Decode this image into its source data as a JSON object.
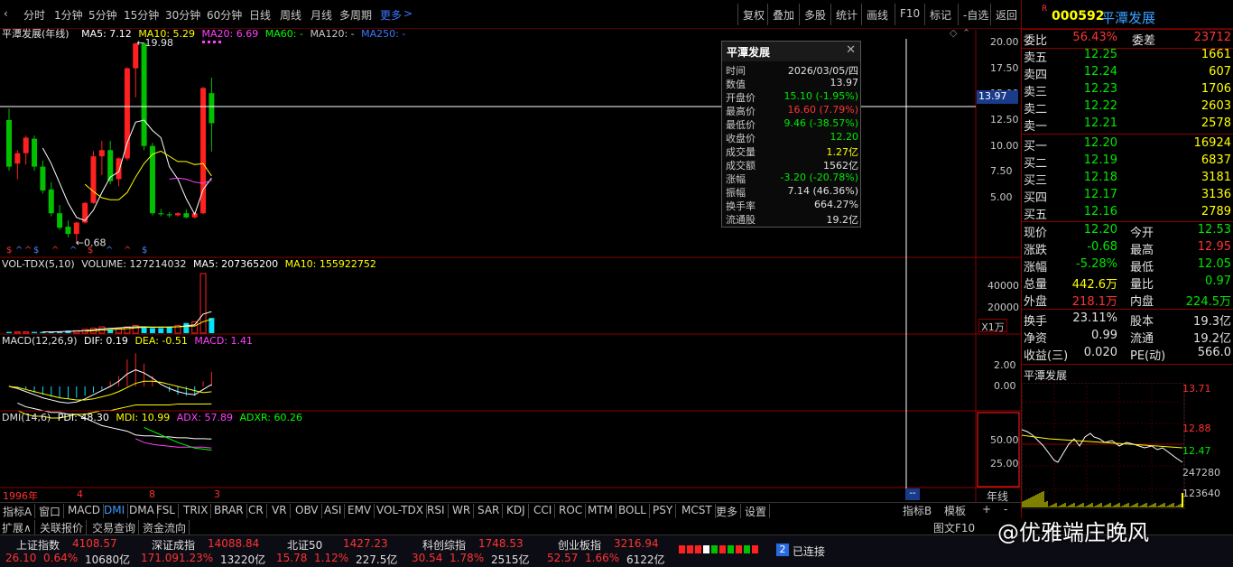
{
  "toolbar": {
    "periods": [
      "分时",
      "1分钟",
      "5分钟",
      "15分钟",
      "30分钟",
      "60分钟",
      "日线",
      "周线",
      "月线",
      "多周期"
    ],
    "more": "更多",
    "actions": [
      "复权",
      "叠加",
      "多股",
      "统计",
      "画线",
      "F10",
      "标记",
      "-自选",
      "返回"
    ]
  },
  "stock": {
    "badge": "R",
    "code": "000592",
    "name": "平潭发展"
  },
  "kline": {
    "title": "平潭发展(年线)",
    "ma5": "MA5: 7.12",
    "ma10": "MA10: 5.29",
    "ma20": "MA20: 6.69",
    "ma60": "MA60: -",
    "ma120": "MA120: -",
    "ma250": "MA250: -",
    "high_label": "19.98",
    "low_label": "0.68",
    "price_ticks": [
      "20.00",
      "17.50",
      "15.00",
      "12.50",
      "10.00",
      "7.50",
      "5.00"
    ],
    "cursor_price": "13.97",
    "colors": {
      "up": "#ff2020",
      "down": "#00c000",
      "ma5": "#ffffff",
      "ma10": "#ffff00",
      "ma20": "#ff40ff",
      "ma60": "#00ff00"
    }
  },
  "volume": {
    "legend_title": "VOL-TDX(5,10)",
    "volume": "VOLUME: 127214032",
    "ma5": "MA5: 207365200",
    "ma10": "MA10: 155922752",
    "ticks": [
      "40000",
      "20000"
    ],
    "unit": "X1万"
  },
  "macd": {
    "legend_title": "MACD(12,26,9)",
    "dif": "DIF: 0.19",
    "dea": "DEA: -0.51",
    "macd": "MACD: 1.41",
    "ticks": [
      "2.00",
      "0.00"
    ]
  },
  "dmi": {
    "legend_title": "DMI(14,6)",
    "pdi": "PDI: 48.30",
    "mdi": "MDI: 10.99",
    "adx": "ADX: 57.89",
    "adxr": "ADXR: 60.26",
    "ticks": [
      "50.00",
      "25.00"
    ]
  },
  "xaxis": {
    "labels": [
      "1996年",
      "4",
      "8",
      "3"
    ],
    "right_label": "年线",
    "cursor_marker": "--"
  },
  "tooltip": {
    "title": "平潭发展",
    "rows": [
      {
        "k": "时间",
        "v": "2026/03/05/四",
        "c": "w"
      },
      {
        "k": "数值",
        "v": "13.97",
        "c": "w"
      },
      {
        "k": "开盘价",
        "v": "15.10 (-1.95%)",
        "c": "g"
      },
      {
        "k": "最高价",
        "v": "16.60 (7.79%)",
        "c": "r"
      },
      {
        "k": "最低价",
        "v": "9.46 (-38.57%)",
        "c": "g"
      },
      {
        "k": "收盘价",
        "v": "12.20",
        "c": "g"
      },
      {
        "k": "成交量",
        "v": "1.27亿",
        "c": "y"
      },
      {
        "k": "成交额",
        "v": "1562亿",
        "c": "w"
      },
      {
        "k": "涨幅",
        "v": "-3.20 (-20.78%)",
        "c": "g"
      },
      {
        "k": "振幅",
        "v": "7.14 (46.36%)",
        "c": "w"
      },
      {
        "k": "换手率",
        "v": "664.27%",
        "c": "w"
      },
      {
        "k": "流通股",
        "v": "19.2亿",
        "c": "w"
      }
    ]
  },
  "quote": {
    "weibi": {
      "k": "委比",
      "v": "56.43%",
      "k2": "委差",
      "v2": "23712"
    },
    "asks": [
      {
        "k": "卖五",
        "p": "12.25",
        "v": "1661"
      },
      {
        "k": "卖四",
        "p": "12.24",
        "v": "607"
      },
      {
        "k": "卖三",
        "p": "12.23",
        "v": "1706"
      },
      {
        "k": "卖二",
        "p": "12.22",
        "v": "2603"
      },
      {
        "k": "卖一",
        "p": "12.21",
        "v": "2578"
      }
    ],
    "bids": [
      {
        "k": "买一",
        "p": "12.20",
        "v": "16924"
      },
      {
        "k": "买二",
        "p": "12.19",
        "v": "6837"
      },
      {
        "k": "买三",
        "p": "12.18",
        "v": "3181"
      },
      {
        "k": "买四",
        "p": "12.17",
        "v": "3136"
      },
      {
        "k": "买五",
        "p": "12.16",
        "v": "2789"
      }
    ],
    "stats": [
      {
        "k1": "现价",
        "v1": "12.20",
        "c1": "g",
        "k2": "今开",
        "v2": "12.53",
        "c2": "g"
      },
      {
        "k1": "涨跌",
        "v1": "-0.68",
        "c1": "g",
        "k2": "最高",
        "v2": "12.95",
        "c2": "r"
      },
      {
        "k1": "涨幅",
        "v1": "-5.28%",
        "c1": "g",
        "k2": "最低",
        "v2": "12.05",
        "c2": "g"
      },
      {
        "k1": "总量",
        "v1": "442.6万",
        "c1": "y",
        "k2": "量比",
        "v2": "0.97",
        "c2": "g"
      },
      {
        "k1": "外盘",
        "v1": "218.1万",
        "c1": "r",
        "k2": "内盘",
        "v2": "224.5万",
        "c2": "g"
      },
      {
        "k1": "换手",
        "v1": "23.11%",
        "c1": "w",
        "k2": "股本",
        "v2": "19.3亿",
        "c2": "w"
      },
      {
        "k1": "净资",
        "v1": "0.99",
        "c1": "w",
        "k2": "流通",
        "v2": "19.2亿",
        "c2": "w"
      },
      {
        "k1": "收益(三)",
        "v1": "0.020",
        "c1": "w",
        "k2": "PE(动)",
        "v2": "566.0",
        "c2": "w"
      }
    ]
  },
  "mini": {
    "title": "平潭发展",
    "ticks": [
      "13.71",
      "12.88",
      "12.47",
      "247280",
      "123640"
    ]
  },
  "bottom_tabs": [
    "指标A",
    "窗口",
    "MACD",
    "DMI",
    "DMA",
    "FSL",
    "TRIX",
    "BRAR",
    "CR",
    "VR",
    "OBV",
    "ASI",
    "EMV",
    "VOL-TDX",
    "RSI",
    "WR",
    "SAR",
    "KDJ",
    "CCI",
    "ROC",
    "MTM",
    "BOLL",
    "PSY",
    "MCST",
    "更多",
    "设置"
  ],
  "bottom_right_tabs": [
    "指标B",
    "模板",
    "+",
    "-"
  ],
  "status_tabs": [
    "扩展∧",
    "关联报价",
    "交易查询",
    "资金流向"
  ],
  "status_right": [
    "图文F10"
  ],
  "indices": [
    {
      "name": "上证指数",
      "val": "4108.57",
      "chg": "26.10",
      "pct": "0.64%",
      "amt": "10680亿"
    },
    {
      "name": "深证成指",
      "val": "14088.84",
      "chg": "171.09",
      "pct": "1.23%",
      "amt": "13220亿"
    },
    {
      "name": "北证50",
      "val": "1427.23",
      "chg": "15.78",
      "pct": "1.12%",
      "amt": "227.5亿"
    },
    {
      "name": "科创综指",
      "val": "1748.53",
      "chg": "30.54",
      "pct": "1.78%",
      "amt": "2515亿"
    },
    {
      "name": "创业板指",
      "val": "3216.94",
      "chg": "52.57",
      "pct": "1.66%",
      "amt": "6122亿"
    }
  ],
  "connection": {
    "num": "2",
    "text": "已连接"
  },
  "watermark": "@优雅端庄晚风"
}
